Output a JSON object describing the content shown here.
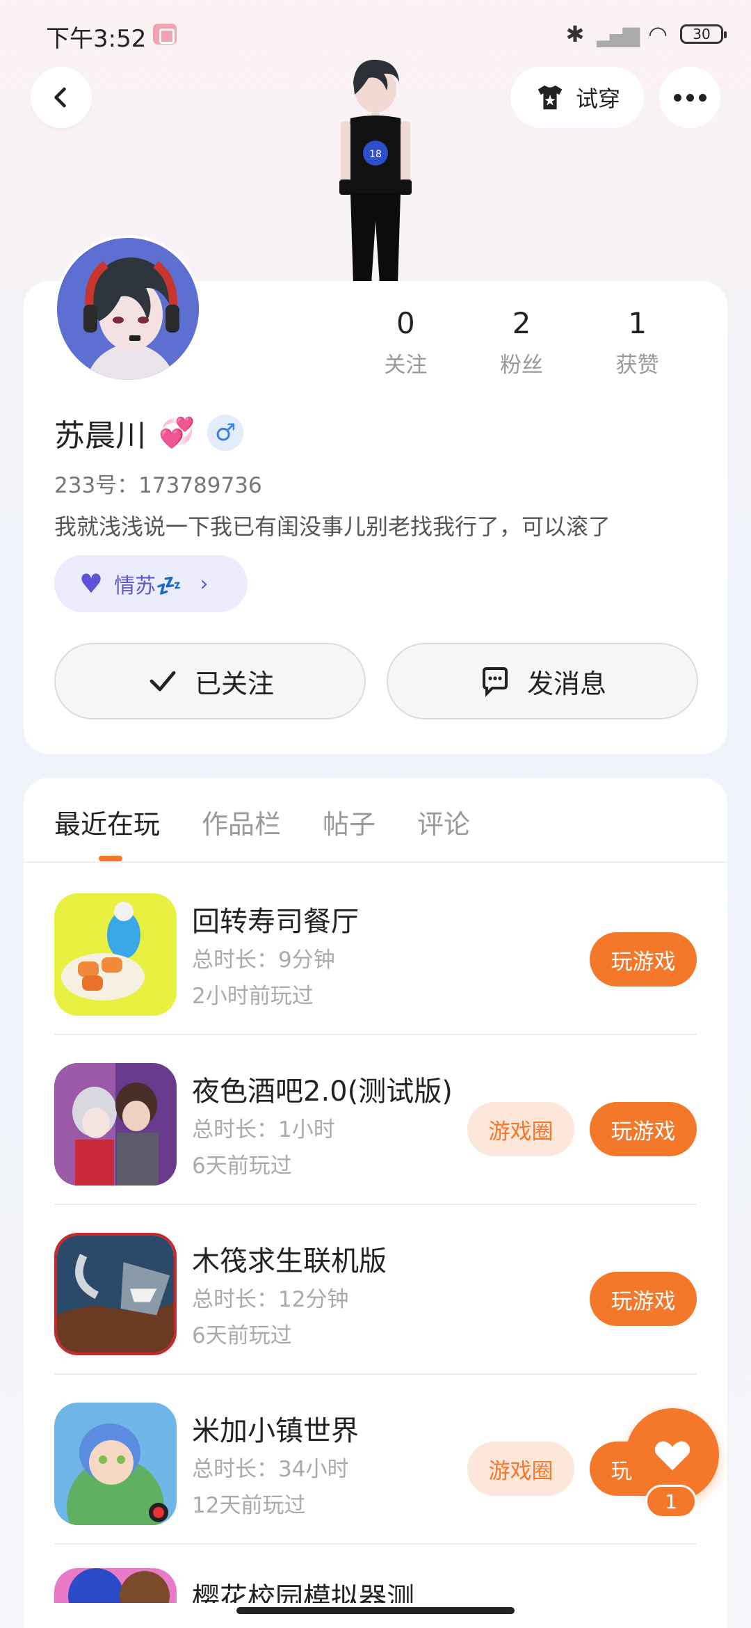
{
  "status_bar": {
    "time": "下午3:52",
    "battery": "30"
  },
  "header": {
    "tryon_label": "试穿"
  },
  "profile": {
    "stats": [
      {
        "num": "0",
        "label": "关注"
      },
      {
        "num": "2",
        "label": "粉丝"
      },
      {
        "num": "1",
        "label": "获赞"
      }
    ],
    "name": "苏晨川",
    "gender": "♂",
    "uid": "233号：173789736",
    "bio": "我就浅浅说一下我已有闺没事儿别老找我行了，可以滚了",
    "cp_tag": "情苏💤",
    "follow_label": "已关注",
    "message_label": "发消息"
  },
  "tabs": [
    "最近在玩",
    "作品栏",
    "帖子",
    "评论"
  ],
  "games": [
    {
      "title": "回转寿司餐厅",
      "duration": "总时长：9分钟",
      "last": "2小时前玩过",
      "circle": "",
      "play": "玩游戏"
    },
    {
      "title": "夜色酒吧2.0(测试版)",
      "duration": "总时长：1小时",
      "last": "6天前玩过",
      "circle": "游戏圈",
      "play": "玩游戏"
    },
    {
      "title": "木筏求生联机版",
      "duration": "总时长：12分钟",
      "last": "6天前玩过",
      "circle": "",
      "play": "玩游戏"
    },
    {
      "title": "米加小镇世界",
      "duration": "总时长：34小时",
      "last": "12天前玩过",
      "circle": "游戏圈",
      "play": "玩游戏"
    },
    {
      "title": "樱花校园模拟器测",
      "duration": "",
      "last": "",
      "circle": "",
      "play": ""
    }
  ],
  "fab": {
    "count": "1"
  },
  "colors": {
    "accent": "#f5782a",
    "accent_soft": "#fde6da",
    "cp_bg": "#ececfd",
    "cp_text": "#6057c9"
  }
}
